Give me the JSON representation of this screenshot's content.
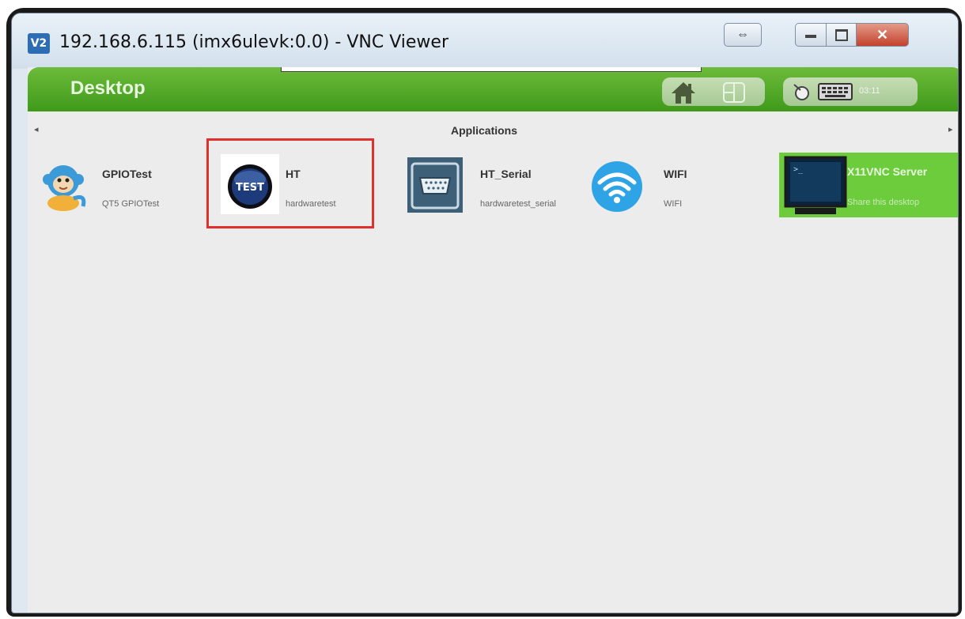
{
  "window": {
    "title": "192.168.6.115 (imx6ulevk:0.0) - VNC Viewer",
    "icon_label": "V2",
    "controls": {
      "toggle": "⇔",
      "close": "✕"
    }
  },
  "desktop": {
    "title": "Desktop",
    "clock": "03:11",
    "section_label": "Applications",
    "nav": {
      "left": "◂",
      "right": "▸"
    }
  },
  "apps": [
    {
      "name": "GPIOTest",
      "subtitle": "QT5 GPIOTest",
      "icon": "monkey-icon"
    },
    {
      "name": "HT",
      "subtitle": "hardwaretest",
      "icon": "test-badge-icon",
      "badge_text": "TEST",
      "highlighted": true
    },
    {
      "name": "HT_Serial",
      "subtitle": "hardwaretest_serial",
      "icon": "serial-port-icon"
    },
    {
      "name": "WIFI",
      "subtitle": "WIFI",
      "icon": "wifi-icon"
    },
    {
      "name": "X11VNC Server",
      "subtitle": "Share this desktop",
      "icon": "terminal-monitor-icon",
      "selected": true
    }
  ],
  "colors": {
    "accent_green": "#3f9a1a",
    "highlight_red": "#e0302b",
    "selected_tile": "#6ccc3b"
  }
}
